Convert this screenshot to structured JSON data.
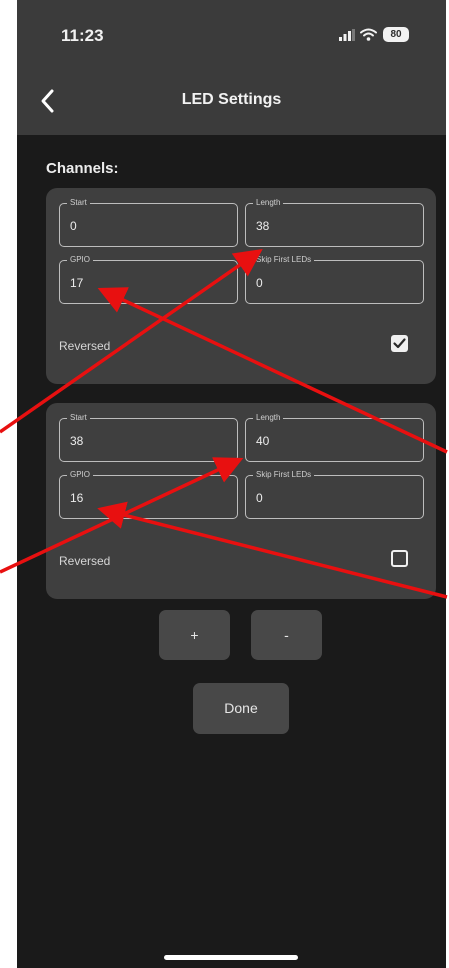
{
  "status_bar": {
    "time": "11:23",
    "battery": "80",
    "icons": [
      "signal-icon",
      "wifi-icon",
      "battery-icon"
    ]
  },
  "nav": {
    "title": "LED Settings",
    "back_icon": "chevron-left-icon"
  },
  "channels_heading": "Channels:",
  "channels": [
    {
      "start_label": "Start",
      "start_value": "0",
      "length_label": "Length",
      "length_value": "38",
      "gpio_label": "GPIO",
      "gpio_value": "17",
      "skip_label": "Skip First LEDs",
      "skip_value": "0",
      "reversed_label": "Reversed",
      "reversed": true
    },
    {
      "start_label": "Start",
      "start_value": "38",
      "length_label": "Length",
      "length_value": "40",
      "gpio_label": "GPIO",
      "gpio_value": "16",
      "skip_label": "Skip First LEDs",
      "skip_value": "0",
      "reversed_label": "Reversed",
      "reversed": false
    }
  ],
  "buttons": {
    "add": "+",
    "remove": "-",
    "done": "Done"
  },
  "colors": {
    "background": "#1a1a1a",
    "bar": "#3b3b3b",
    "card": "#3f3f3f",
    "button": "#484848",
    "annotation_arrow": "#e81010"
  }
}
